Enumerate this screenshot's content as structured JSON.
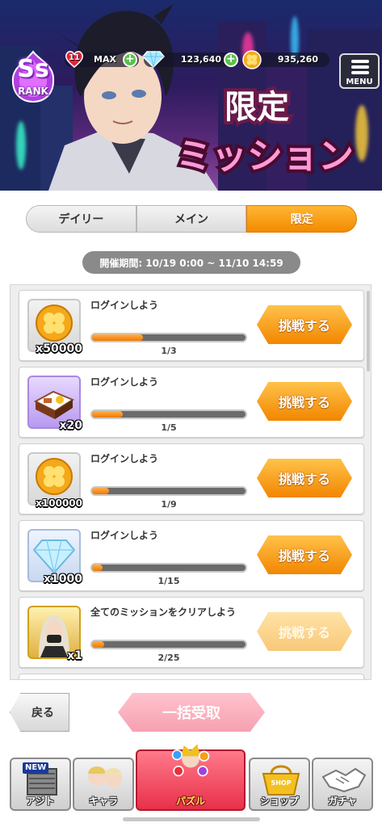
{
  "header": {
    "rank_letters": "Ss",
    "rank_label": "RANK",
    "stamina_value": "11",
    "stamina_max": "MAX",
    "gems": "123,640",
    "coins": "935,260",
    "menu_label": "MENU",
    "title_line1": "限定",
    "title_line2": "ミッション"
  },
  "tabs": [
    {
      "label": "デイリー",
      "active": false
    },
    {
      "label": "メイン",
      "active": false
    },
    {
      "label": "限定",
      "active": true
    }
  ],
  "period": "開催期間: 10/19 0:00 ~ 11/10 14:59",
  "missions": [
    {
      "title": "ログインしよう",
      "reward_icon": "clover-coin-icon",
      "reward_count": "x50000",
      "progress_text": "1/3",
      "progress": 0.333,
      "button": "挑戦する",
      "enabled": true
    },
    {
      "title": "ログインしよう",
      "reward_icon": "bento-box-icon",
      "reward_count": "x20",
      "progress_text": "1/5",
      "progress": 0.2,
      "button": "挑戦する",
      "enabled": true
    },
    {
      "title": "ログインしよう",
      "reward_icon": "clover-coin-icon",
      "reward_count": "x100000",
      "progress_text": "1/9",
      "progress": 0.111,
      "button": "挑戦する",
      "enabled": true
    },
    {
      "title": "ログインしよう",
      "reward_icon": "diamond-gem-icon",
      "reward_count": "x1000",
      "progress_text": "1/15",
      "progress": 0.067,
      "button": "挑戦する",
      "enabled": true
    },
    {
      "title": "全てのミッションをクリアしよう",
      "reward_icon": "character-portrait-icon",
      "reward_count": "x1",
      "progress_text": "2/25",
      "progress": 0.08,
      "button": "挑戦する",
      "enabled": false
    }
  ],
  "footer": {
    "back_label": "戻る",
    "collect_label": "一括受取"
  },
  "nav": [
    {
      "label": "アジト",
      "icon": "hideout-icon",
      "badge": "NEW"
    },
    {
      "label": "キャラ",
      "icon": "characters-icon"
    },
    {
      "label": "パズル",
      "icon": "puzzle-icon",
      "active": true
    },
    {
      "label": "ショップ",
      "icon": "shop-basket-icon",
      "shop_tag": "SHOP"
    },
    {
      "label": "ガチャ",
      "icon": "handshake-icon"
    }
  ],
  "colors": {
    "accent_orange": "#f28600",
    "progress_fill": "#f07800",
    "active_nav": "#e8304a",
    "collect_disabled": "#f6a0b0"
  }
}
